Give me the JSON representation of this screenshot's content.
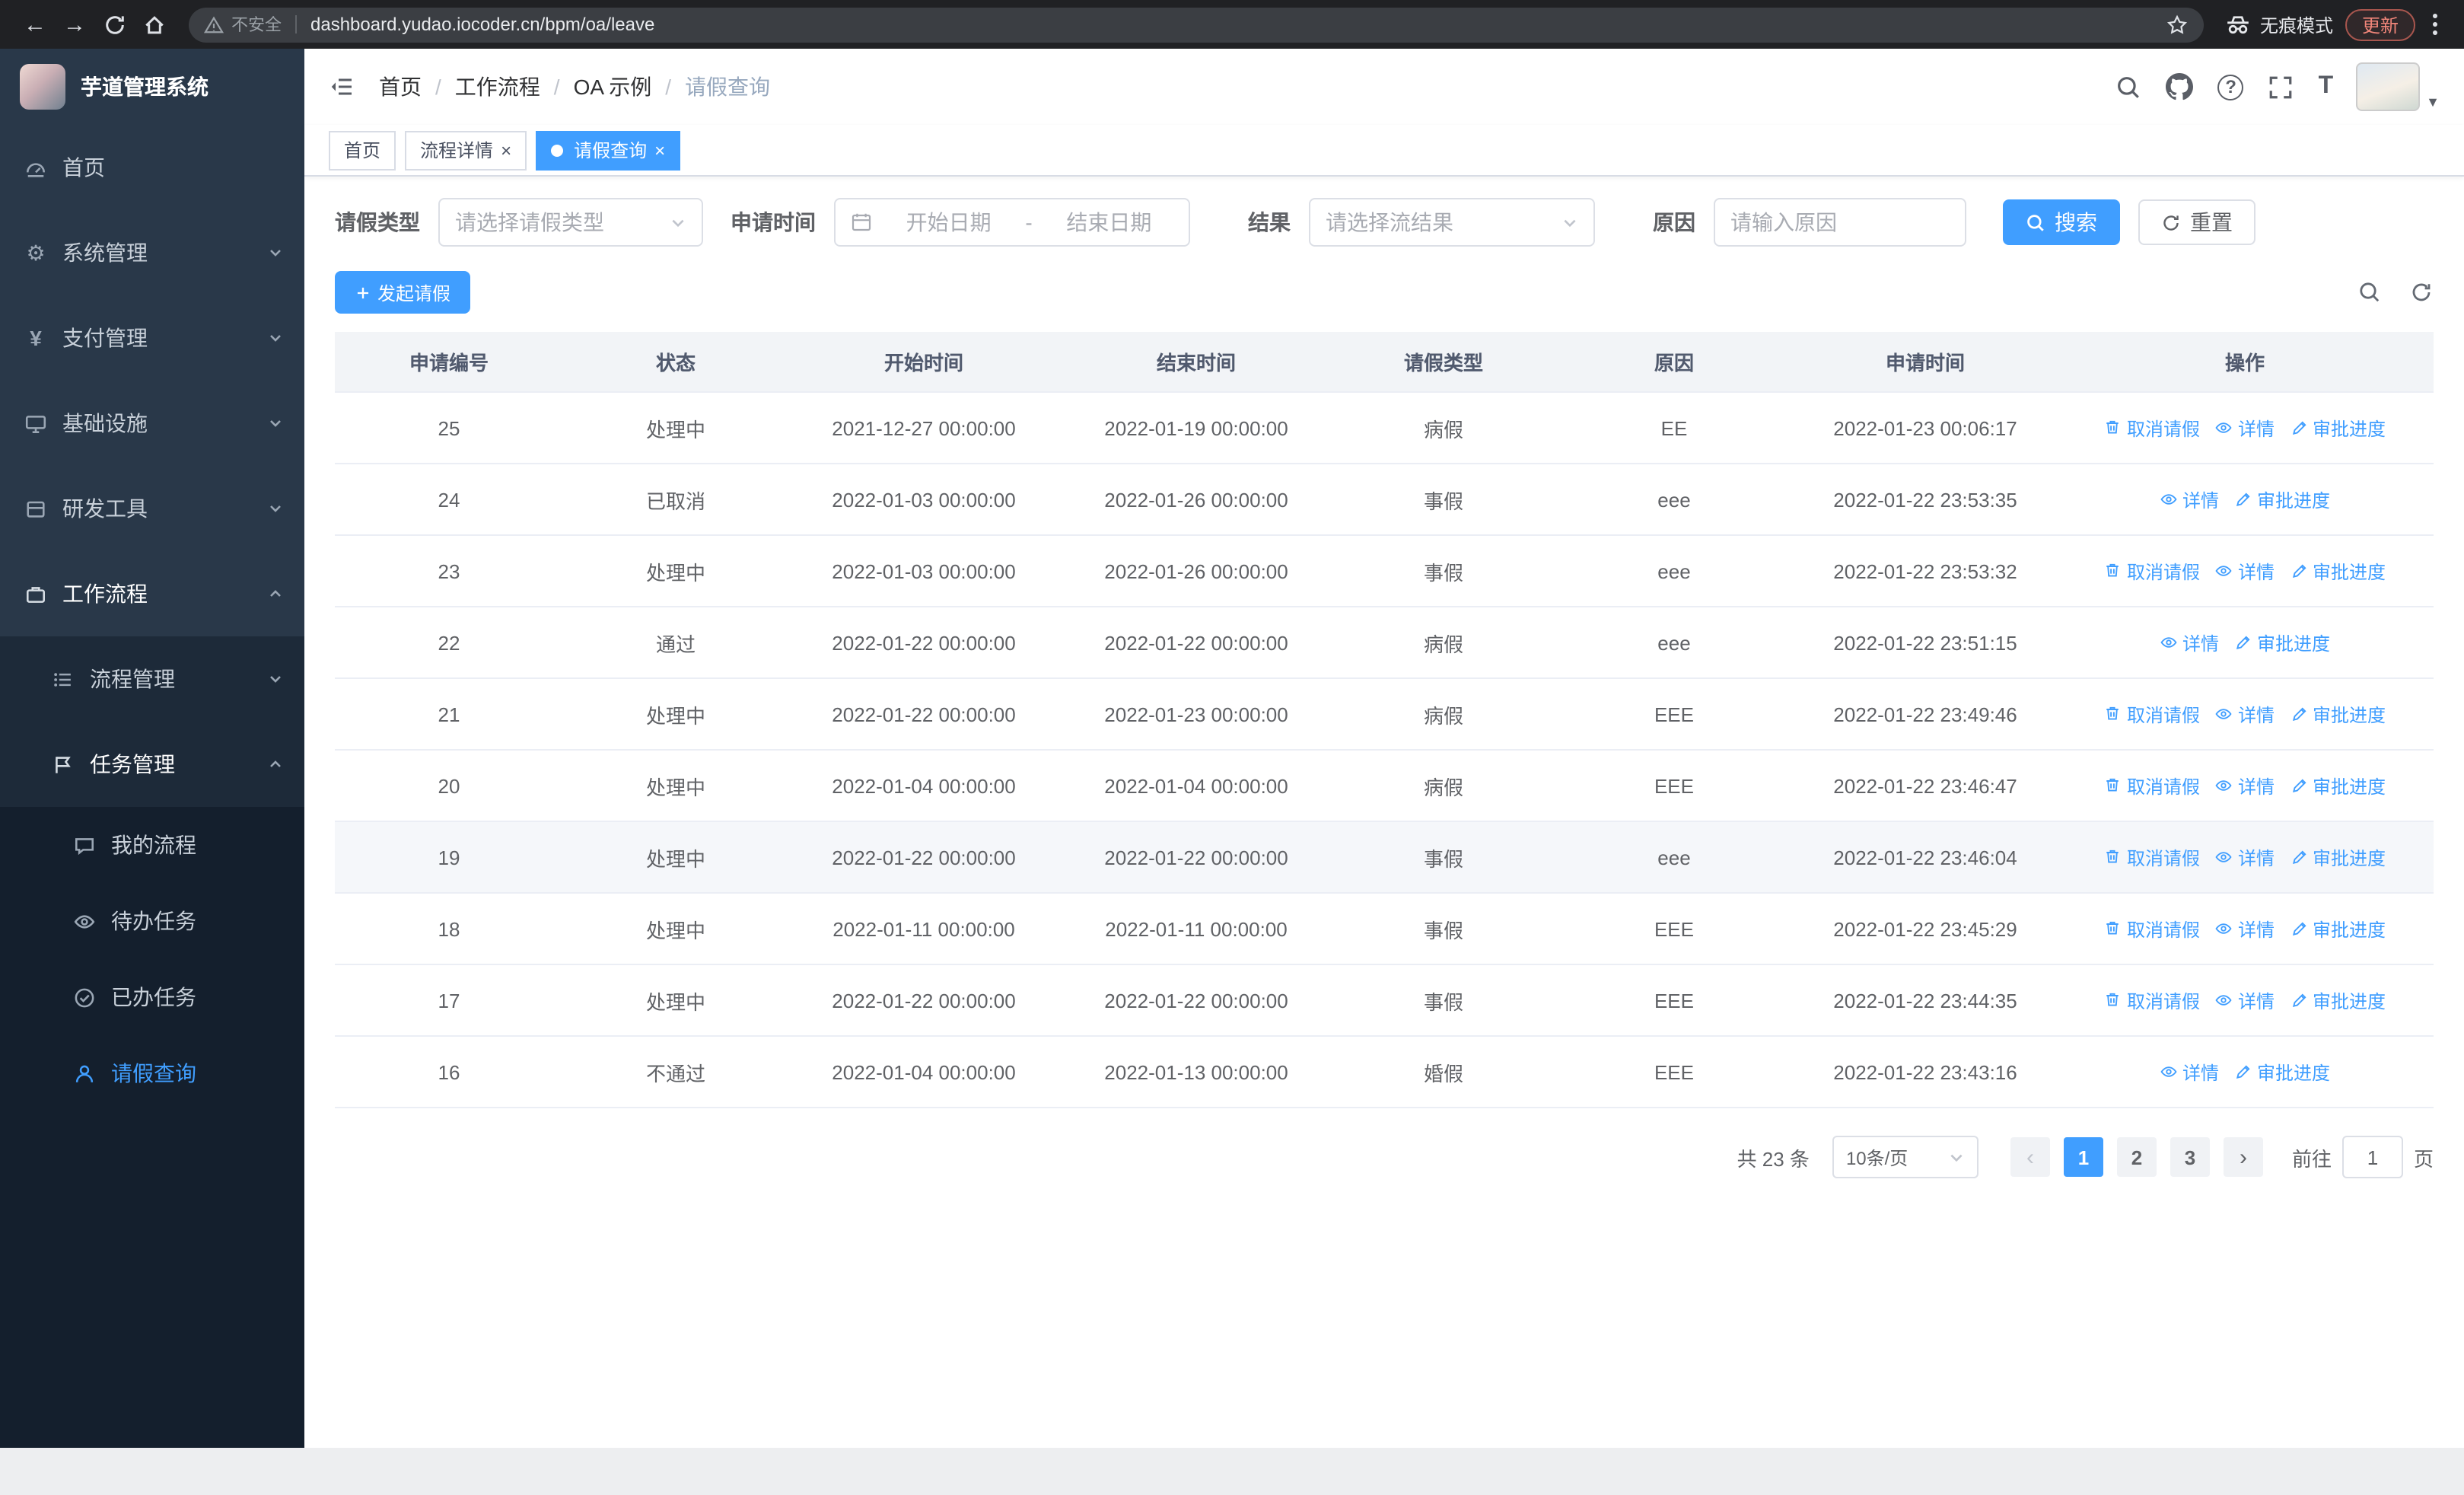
{
  "browser": {
    "security_label": "不安全",
    "url": "dashboard.yudao.iocoder.cn/bpm/oa/leave",
    "incognito_label": "无痕模式",
    "update_label": "更新"
  },
  "icons": {
    "browser": [
      "back-icon",
      "forward-icon",
      "reload-icon",
      "home-icon",
      "warning-icon",
      "star-icon",
      "incognito-icon",
      "kebab-menu-icon"
    ],
    "header": [
      "menu-fold-icon",
      "search-icon",
      "github-icon",
      "question-icon",
      "fullscreen-icon",
      "font-size-icon",
      "chevron-down-icon"
    ],
    "table_actions": [
      "delete-icon",
      "view-icon",
      "edit-icon"
    ],
    "filters": [
      "calendar-icon",
      "refresh-icon",
      "plus-icon"
    ]
  },
  "sidebar": {
    "logo_title": "芋道管理系统",
    "items": [
      {
        "label": "首页",
        "icon": "dashboard-icon"
      },
      {
        "label": "系统管理",
        "icon": "gear-icon",
        "expandable": true
      },
      {
        "label": "支付管理",
        "icon": "yen-icon",
        "expandable": true
      },
      {
        "label": "基础设施",
        "icon": "monitor-icon",
        "expandable": true
      },
      {
        "label": "研发工具",
        "icon": "toolbox-icon",
        "expandable": true
      },
      {
        "label": "工作流程",
        "icon": "briefcase-icon",
        "expanded": true
      }
    ],
    "submenu": [
      {
        "label": "流程管理",
        "icon": "list-icon",
        "expandable": true
      },
      {
        "label": "任务管理",
        "icon": "flag-icon",
        "expanded": true
      }
    ],
    "tasks": [
      {
        "label": "我的流程",
        "icon": "chat-icon"
      },
      {
        "label": "待办任务",
        "icon": "eye-icon"
      },
      {
        "label": "已办任务",
        "icon": "check-circle-icon"
      },
      {
        "label": "请假查询",
        "icon": "user-icon",
        "active": true
      }
    ]
  },
  "header": {
    "breadcrumb": [
      "首页",
      "工作流程",
      "OA 示例",
      "请假查询"
    ],
    "breadcrumb_separator": "/"
  },
  "tabs": [
    {
      "label": "首页",
      "closable": false,
      "active": false
    },
    {
      "label": "流程详情",
      "closable": true,
      "active": false
    },
    {
      "label": "请假查询",
      "closable": true,
      "active": true
    }
  ],
  "filters": {
    "leave_type_label": "请假类型",
    "leave_type_placeholder": "请选择请假类型",
    "apply_time_label": "申请时间",
    "start_date_placeholder": "开始日期",
    "date_separator": "-",
    "end_date_placeholder": "结束日期",
    "result_label": "结果",
    "result_placeholder": "请选择流结果",
    "reason_label": "原因",
    "reason_placeholder": "请输入原因",
    "search_button": "搜索",
    "reset_button": "重置"
  },
  "toolbar": {
    "create_button": "发起请假"
  },
  "table": {
    "columns": [
      "申请编号",
      "状态",
      "开始时间",
      "结束时间",
      "请假类型",
      "原因",
      "申请时间",
      "操作"
    ],
    "actions": {
      "cancel": "取消请假",
      "detail": "详情",
      "progress": "审批进度"
    },
    "rows": [
      {
        "id": "25",
        "status": "处理中",
        "start": "2021-12-27 00:00:00",
        "end": "2022-01-19 00:00:00",
        "type": "病假",
        "reason": "EE",
        "apply_time": "2022-01-23 00:06:17",
        "cancelable": true,
        "highlighted": false
      },
      {
        "id": "24",
        "status": "已取消",
        "start": "2022-01-03 00:00:00",
        "end": "2022-01-26 00:00:00",
        "type": "事假",
        "reason": "eee",
        "apply_time": "2022-01-22 23:53:35",
        "cancelable": false,
        "highlighted": false
      },
      {
        "id": "23",
        "status": "处理中",
        "start": "2022-01-03 00:00:00",
        "end": "2022-01-26 00:00:00",
        "type": "事假",
        "reason": "eee",
        "apply_time": "2022-01-22 23:53:32",
        "cancelable": true,
        "highlighted": false
      },
      {
        "id": "22",
        "status": "通过",
        "start": "2022-01-22 00:00:00",
        "end": "2022-01-22 00:00:00",
        "type": "病假",
        "reason": "eee",
        "apply_time": "2022-01-22 23:51:15",
        "cancelable": false,
        "highlighted": false
      },
      {
        "id": "21",
        "status": "处理中",
        "start": "2022-01-22 00:00:00",
        "end": "2022-01-23 00:00:00",
        "type": "病假",
        "reason": "EEE",
        "apply_time": "2022-01-22 23:49:46",
        "cancelable": true,
        "highlighted": false
      },
      {
        "id": "20",
        "status": "处理中",
        "start": "2022-01-04 00:00:00",
        "end": "2022-01-04 00:00:00",
        "type": "病假",
        "reason": "EEE",
        "apply_time": "2022-01-22 23:46:47",
        "cancelable": true,
        "highlighted": false
      },
      {
        "id": "19",
        "status": "处理中",
        "start": "2022-01-22 00:00:00",
        "end": "2022-01-22 00:00:00",
        "type": "事假",
        "reason": "eee",
        "apply_time": "2022-01-22 23:46:04",
        "cancelable": true,
        "highlighted": true
      },
      {
        "id": "18",
        "status": "处理中",
        "start": "2022-01-11 00:00:00",
        "end": "2022-01-11 00:00:00",
        "type": "事假",
        "reason": "EEE",
        "apply_time": "2022-01-22 23:45:29",
        "cancelable": true,
        "highlighted": false
      },
      {
        "id": "17",
        "status": "处理中",
        "start": "2022-01-22 00:00:00",
        "end": "2022-01-22 00:00:00",
        "type": "事假",
        "reason": "EEE",
        "apply_time": "2022-01-22 23:44:35",
        "cancelable": true,
        "highlighted": false
      },
      {
        "id": "16",
        "status": "不通过",
        "start": "2022-01-04 00:00:00",
        "end": "2022-01-13 00:00:00",
        "type": "婚假",
        "reason": "EEE",
        "apply_time": "2022-01-22 23:43:16",
        "cancelable": false,
        "highlighted": false
      }
    ]
  },
  "pagination": {
    "total_label": "共 23 条",
    "page_size": "10条/页",
    "prev_icon": "‹",
    "next_icon": "›",
    "pages": [
      "1",
      "2",
      "3"
    ],
    "active_page": "1",
    "goto_label": "前往",
    "goto_value": "1",
    "goto_suffix": "页"
  }
}
